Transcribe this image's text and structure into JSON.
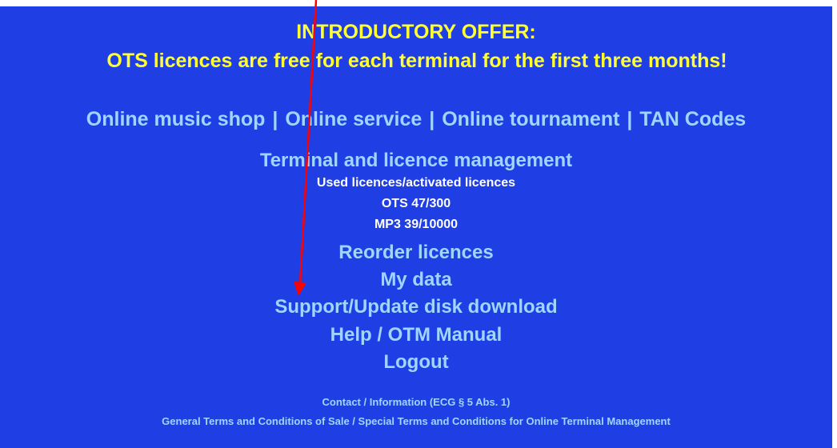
{
  "offer": {
    "title": "INTRODUCTORY OFFER:",
    "text": "OTS licences are free for each terminal for the first three months!"
  },
  "nav": {
    "links": [
      "Online music shop",
      "Online service",
      "Online tournament",
      "TAN Codes"
    ],
    "separator": "|"
  },
  "management": {
    "title": "Terminal and licence management",
    "used_label": "Used licences/activated licences",
    "ots": "OTS 47/300",
    "mp3": "MP3 39/10000"
  },
  "menu": {
    "reorder": "Reorder licences",
    "my_data": "My data",
    "support": "Support/Update disk download",
    "help": "Help / OTM Manual",
    "logout": "Logout"
  },
  "footer": {
    "contact": "Contact / Information (ECG § 5 Abs. 1)",
    "terms": "General Terms and Conditions of Sale / Special Terms and Conditions for Online Terminal Management"
  },
  "annotation": {
    "arrow_color": "#ff0000"
  },
  "colors": {
    "background": "#1f3fe4",
    "offer_text": "#ffff33",
    "link": "#9ed6ff",
    "info_text": "#ffffff"
  }
}
